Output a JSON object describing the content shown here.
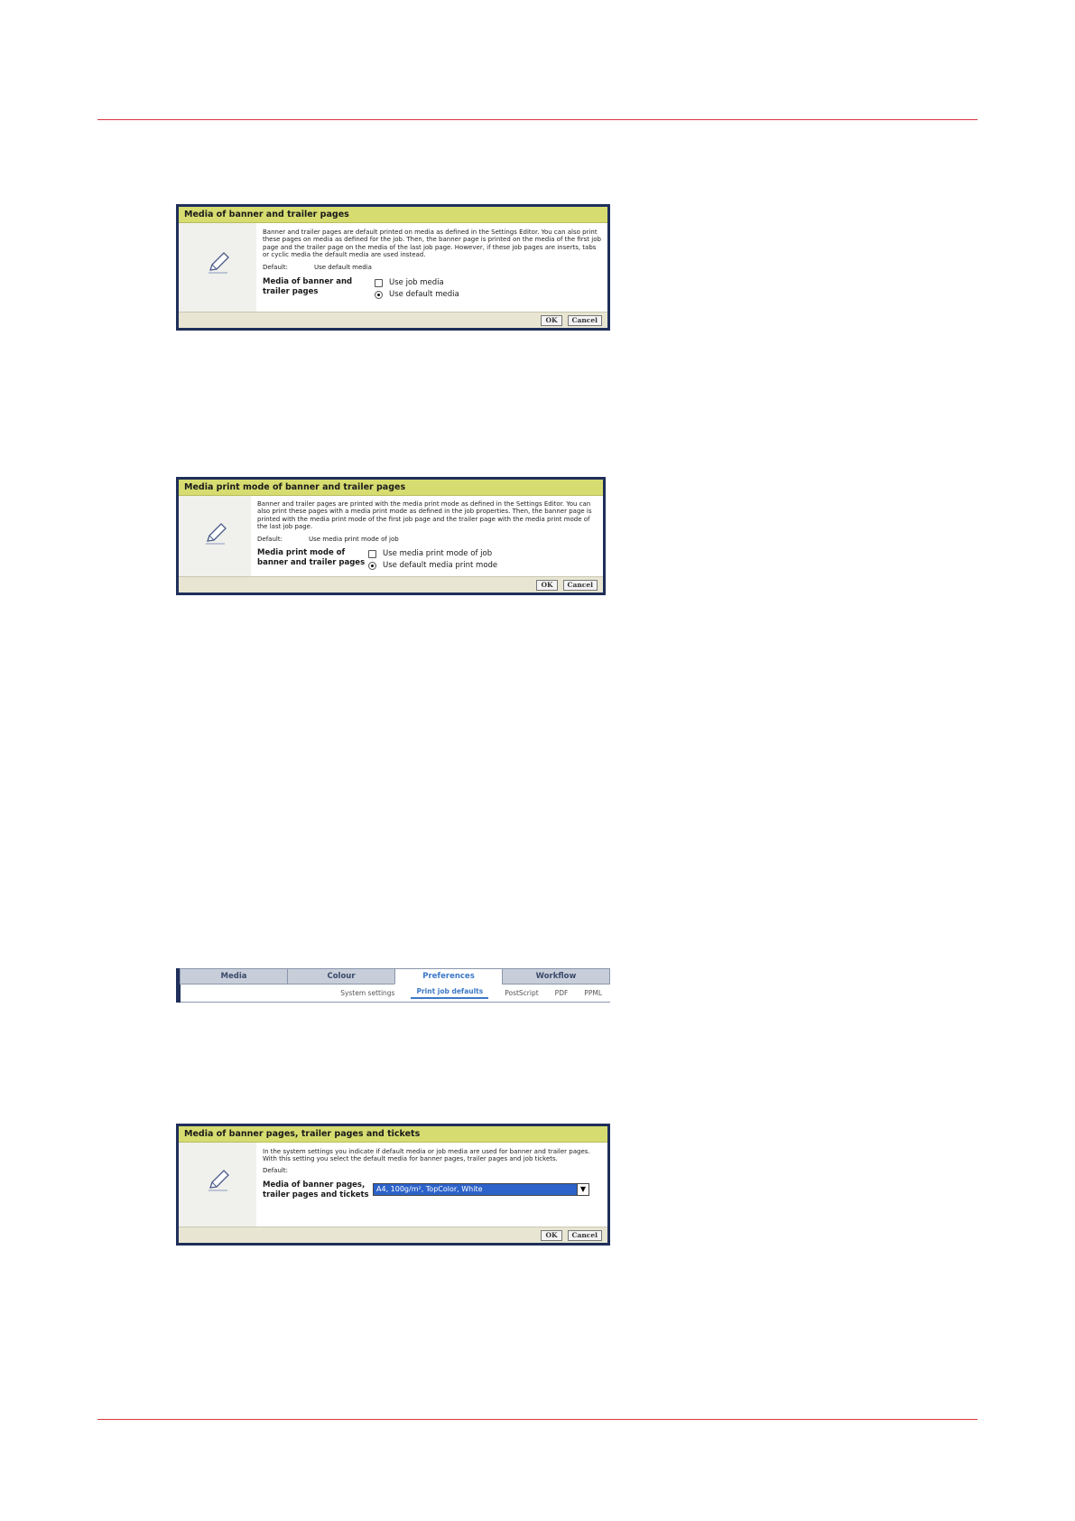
{
  "dialog1": {
    "title": "Media of banner and trailer pages",
    "description": "Banner and trailer pages are default printed on media as defined in the Settings Editor. You can also print these pages on media as defined for the job. Then, the banner page is printed on the media of the first job page and the trailer page on the media of the last job page. However, if these job pages are inserts, tabs or cyclic media the default media are used instead.",
    "default_label": "Default:",
    "default_value": "Use default media",
    "setting_name": "Media of banner and trailer pages",
    "options": [
      "Use job media",
      "Use default media"
    ],
    "selected_option": "Use default media",
    "ok": "OK",
    "cancel": "Cancel"
  },
  "dialog2": {
    "title": "Media print mode of banner and trailer pages",
    "description": "Banner and trailer pages are printed with the media print mode as defined in the Settings Editor. You can also print these pages with a media print mode as defined in the job properties. Then, the banner page is printed with the media print mode of the first job page and the trailer page with the media print mode of the last job page.",
    "default_label": "Default:",
    "default_value": "Use media print mode of job",
    "setting_name": "Media print mode of banner and trailer pages",
    "options": [
      "Use media print mode of job",
      "Use default media print mode"
    ],
    "selected_option": "Use default media print mode",
    "ok": "OK",
    "cancel": "Cancel"
  },
  "tabs": {
    "main": [
      "Media",
      "Colour",
      "Preferences",
      "Workflow"
    ],
    "active_main": "Preferences",
    "sub": [
      "System settings",
      "Print job defaults",
      "PostScript",
      "PDF",
      "PPML"
    ],
    "active_sub": "Print job defaults"
  },
  "dialog3": {
    "title": "Media of banner pages, trailer pages and tickets",
    "description": "In the system settings you indicate if default media or job media are used for banner and trailer pages. With this setting you select the default media for banner pages, trailer pages and job tickets.",
    "default_label": "Default:",
    "setting_name": "Media of banner pages, trailer pages and tickets",
    "select_value": "A4, 100g/m², TopColor, White",
    "ok": "OK",
    "cancel": "Cancel"
  },
  "colors": {
    "title_bar": "#d6dc70",
    "frame": "#1f2f5a",
    "rule": "#d9363e",
    "select_highlight": "#2c62c9"
  }
}
